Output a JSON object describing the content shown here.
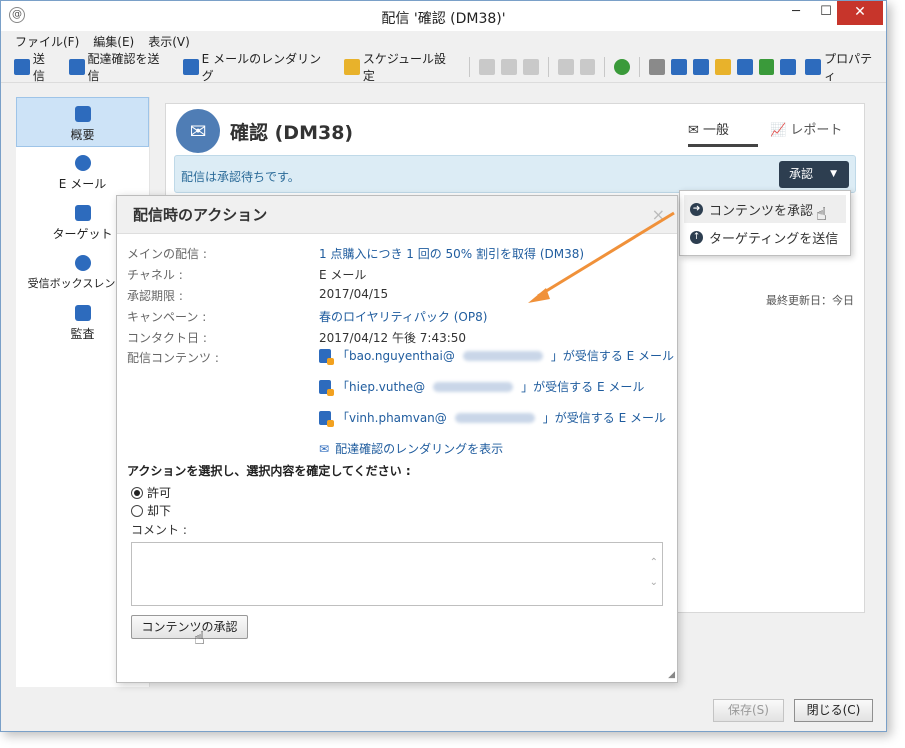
{
  "window": {
    "title": "配信 '確認 (DM38)'",
    "app_icon": "app-icon",
    "minimize": "─",
    "maximize": "☐",
    "close": "✕"
  },
  "menu": [
    "ファイル(F)",
    "編集(E)",
    "表示(V)"
  ],
  "toolbar": {
    "send": "送信",
    "send_proof": "配達確認を送信",
    "email_render": "E メールのレンダリング",
    "schedule": "スケジュール設定",
    "properties": "プロパティ"
  },
  "sidebar": [
    {
      "label": "概要",
      "icon": "overview-icon",
      "active": true
    },
    {
      "label": "E メール",
      "icon": "email-icon"
    },
    {
      "label": "ターゲット",
      "icon": "target-icon"
    },
    {
      "label": "受信ボックスレンダリ",
      "icon": "inbox-rendering-icon"
    },
    {
      "label": "監査",
      "icon": "audit-icon"
    }
  ],
  "header": {
    "title": "確認 (DM38)",
    "tab_general": "一般",
    "tab_report": "レポート"
  },
  "status": {
    "text": "配信は承認待ちです。",
    "approve_label": "承認",
    "last_update": "最終更新日：今日"
  },
  "dropdown": {
    "item1": "コンテンツを承認",
    "item2": "ターゲティングを送信"
  },
  "dialog": {
    "title": "配信時のアクション",
    "close": "×",
    "rows": [
      {
        "label": "メインの配信 :",
        "value": "1 点購入につき 1 回の 50% 割引を取得 (DM38)",
        "link": true
      },
      {
        "label": "チャネル :",
        "value": "E メール"
      },
      {
        "label": "承認期限 :",
        "value": "2017/04/15"
      },
      {
        "label": "キャンペーン :",
        "value": "春のロイヤリティパック (OP8)",
        "link": true
      },
      {
        "label": "コンタクト日 :",
        "value": "2017/04/12 午後 7:43:50"
      },
      {
        "label": "配信コンテンツ :",
        "value": ""
      }
    ],
    "contents": [
      {
        "pre": "「bao.nguyenthai@",
        "post": "」が受信する E メール"
      },
      {
        "pre": "「hiep.vuthe@",
        "post": "」が受信する E メール"
      },
      {
        "pre": "「vinh.phamvan@",
        "post": "」が受信する E メール"
      }
    ],
    "render_link": "配達確認のレンダリングを表示",
    "action_prompt": "アクションを選択し、選択内容を確定してください :",
    "radio_allow": "許可",
    "radio_reject": "却下",
    "comment_label": "コメント :",
    "submit": "コンテンツの承認"
  },
  "footer": {
    "save": "保存(S)",
    "close": "閉じる(C)"
  },
  "colors": {
    "accent": "#2d3e50",
    "link": "#1f5c9e",
    "arrow": "#f0913a",
    "close_red": "#c7352b"
  }
}
